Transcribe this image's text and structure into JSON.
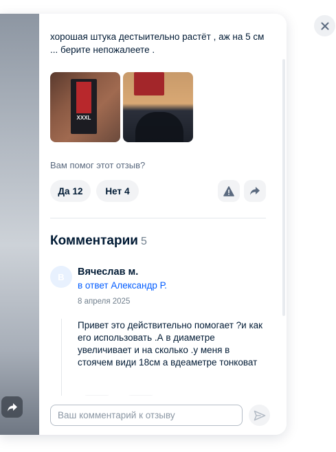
{
  "review": {
    "text": "хорошая штука дестыительно растёт , аж на 5 см ... берите непожалеете .",
    "photos": [
      {
        "icon": "product-photo-1",
        "label": "XXXL"
      },
      {
        "icon": "product-photo-2"
      }
    ]
  },
  "helpful": {
    "question": "Вам помог этот отзыв?",
    "yes_label": "Да",
    "yes_count": "12",
    "no_label": "Нет",
    "no_count": "4"
  },
  "comments": {
    "title": "Комментарии",
    "count": "5",
    "items": [
      {
        "avatar_letter": "В",
        "author": "Вячеслав м.",
        "reply_to": "в ответ Александр Р.",
        "date": "8 апреля 2025",
        "text": "Привет это действительно помогает ?и как его использовать .А в диаметре увеличивает и на сколько .у меня в стоячем види 18см а вдеаметре тонковат"
      }
    ]
  },
  "input": {
    "placeholder": "Ваш комментарий к отзыву",
    "value": ""
  },
  "icons": {
    "close": "close-icon",
    "report": "report-icon",
    "share": "share-icon",
    "send": "send-icon",
    "photo_share": "share-icon"
  },
  "colors": {
    "text": "#001a34",
    "secondary": "#707f8d",
    "link": "#005bff",
    "pill_bg": "#f2f3f5",
    "avatar_bg": "#e8f1fe"
  }
}
